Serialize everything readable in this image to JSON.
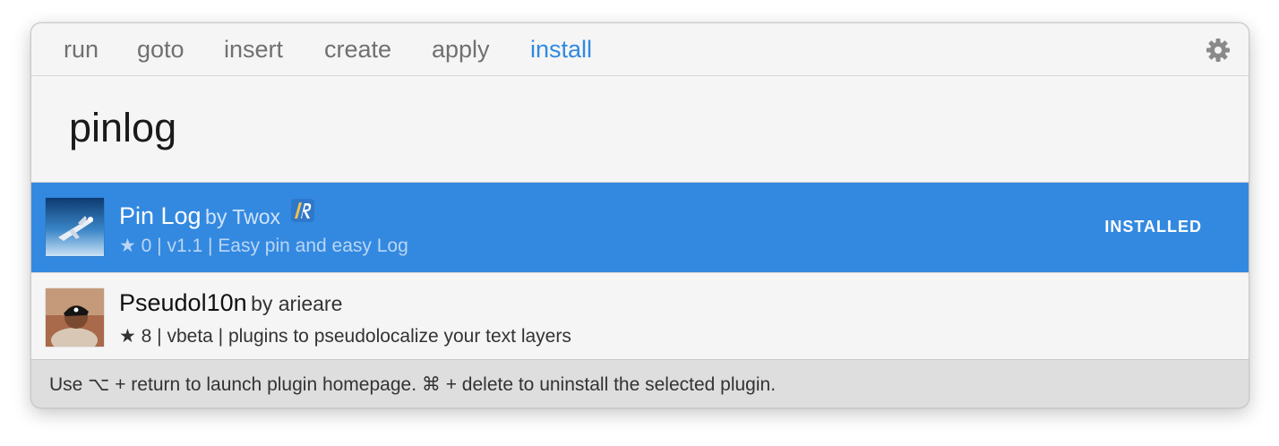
{
  "tabs": [
    {
      "label": "run"
    },
    {
      "label": "goto"
    },
    {
      "label": "insert"
    },
    {
      "label": "create"
    },
    {
      "label": "apply"
    },
    {
      "label": "install",
      "active": true
    }
  ],
  "settings_icon": "gear-icon",
  "search": {
    "value": "pinlog"
  },
  "results": [
    {
      "title": "Pin Log",
      "by": "by Twox",
      "badge_icon": "r-badge-icon",
      "meta": "★ 0 | v1.1 | Easy pin and easy Log",
      "status": "INSTALLED",
      "selected": true
    },
    {
      "title": "Pseudol10n",
      "by": "by arieare",
      "meta": "★ 8 | vbeta | plugins to pseudolocalize your text layers",
      "selected": false
    }
  ],
  "footer": {
    "hint": "Use ⌥ + return to launch plugin homepage. ⌘ + delete to uninstall the selected plugin."
  },
  "colors": {
    "accent": "#3389e0",
    "active_tab": "#2f8ae0",
    "background": "#f5f5f5",
    "footer_bg": "#dedede"
  }
}
